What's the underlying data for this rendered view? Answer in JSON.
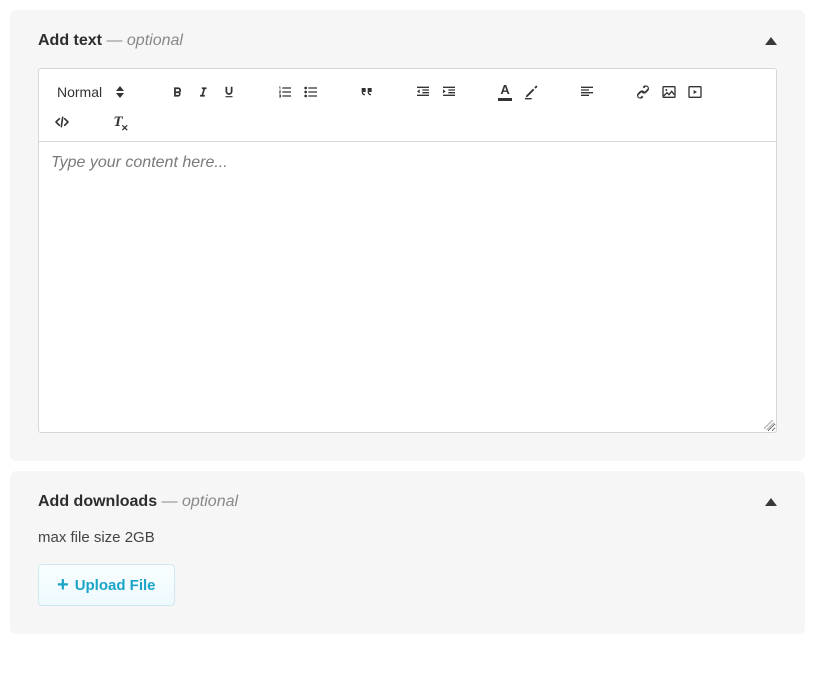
{
  "text_panel": {
    "title": "Add text",
    "optional_suffix": " — optional",
    "toolbar": {
      "heading_label": "Normal"
    },
    "editor": {
      "placeholder": "Type your content here..."
    }
  },
  "downloads_panel": {
    "title": "Add downloads",
    "optional_suffix": " — optional",
    "hint": "max file size 2GB",
    "upload_label": "Upload File"
  }
}
